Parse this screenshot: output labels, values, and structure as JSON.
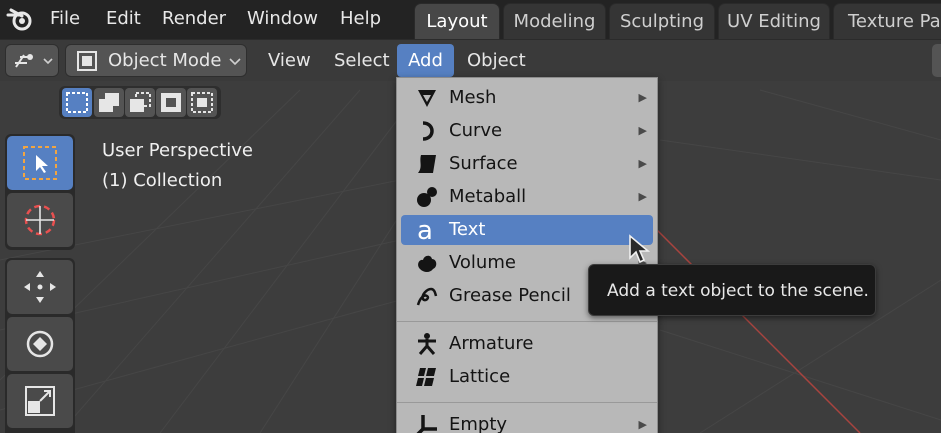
{
  "topbar": {
    "menus": [
      "File",
      "Edit",
      "Render",
      "Window",
      "Help"
    ],
    "workspace_tabs": [
      {
        "label": "Layout",
        "active": true
      },
      {
        "label": "Modeling",
        "active": false
      },
      {
        "label": "Sculpting",
        "active": false
      },
      {
        "label": "UV Editing",
        "active": false
      },
      {
        "label": "Texture Pai",
        "active": false
      }
    ]
  },
  "header": {
    "mode": "Object Mode",
    "menus": [
      "View",
      "Select",
      "Add",
      "Object"
    ],
    "active_menu": "Add"
  },
  "viewport": {
    "perspective": "User Perspective",
    "collection": "(1) Collection"
  },
  "add_menu": {
    "items": [
      {
        "label": "Mesh",
        "icon": "mesh-icon",
        "submenu": true
      },
      {
        "label": "Curve",
        "icon": "curve-icon",
        "submenu": true
      },
      {
        "label": "Surface",
        "icon": "surface-icon",
        "submenu": true
      },
      {
        "label": "Metaball",
        "icon": "metaball-icon",
        "submenu": true
      },
      {
        "label": "Text",
        "icon": "text-icon",
        "submenu": false,
        "hover": true
      },
      {
        "label": "Volume",
        "icon": "volume-icon",
        "submenu": true
      },
      {
        "label": "Grease Pencil",
        "icon": "grease-pencil-icon",
        "submenu": true
      },
      {
        "label": "Armature",
        "icon": "armature-icon",
        "submenu": false
      },
      {
        "label": "Lattice",
        "icon": "lattice-icon",
        "submenu": false
      },
      {
        "label": "Empty",
        "icon": "empty-icon",
        "submenu": true
      }
    ]
  },
  "tooltip": {
    "text": "Add a text object to the scene."
  },
  "colors": {
    "accent": "#5680c2",
    "menu_bg": "#b8b8b8",
    "viewport_bg": "#3d3d3d",
    "axis_line": "#a8443f"
  }
}
